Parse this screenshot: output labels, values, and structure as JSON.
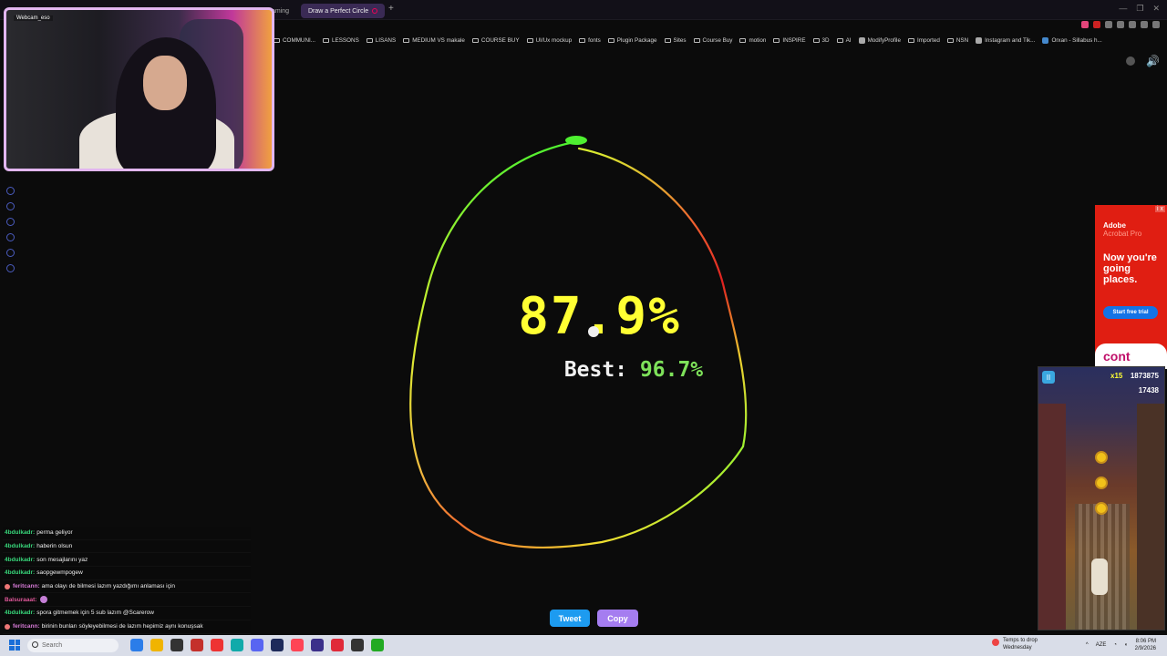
{
  "browser": {
    "tabs": [
      {
        "label": "aming"
      },
      {
        "label": "Draw a Perfect Circle"
      }
    ],
    "new_tab": "+",
    "window_controls": [
      "—",
      "❐",
      "✕"
    ]
  },
  "bookmarks": [
    {
      "label": "COMMUNI...",
      "kind": "folder"
    },
    {
      "label": "LESSONS",
      "kind": "folder"
    },
    {
      "label": "LISANS",
      "kind": "folder"
    },
    {
      "label": "MEDIUM VS makale",
      "kind": "folder"
    },
    {
      "label": "COURSE BUY",
      "kind": "folder"
    },
    {
      "label": "UI/Ux mockup",
      "kind": "folder"
    },
    {
      "label": "fonts",
      "kind": "folder"
    },
    {
      "label": "Plugin Package",
      "kind": "folder"
    },
    {
      "label": "Sites",
      "kind": "folder"
    },
    {
      "label": "Course Buy",
      "kind": "folder"
    },
    {
      "label": "motion",
      "kind": "folder"
    },
    {
      "label": "INSPIRE",
      "kind": "folder"
    },
    {
      "label": "3D",
      "kind": "folder"
    },
    {
      "label": "AI",
      "kind": "folder"
    },
    {
      "label": "ModifyProfile",
      "kind": "site"
    },
    {
      "label": "Imported",
      "kind": "folder"
    },
    {
      "label": "NSN",
      "kind": "folder"
    },
    {
      "label": "Instagram and Tik...",
      "kind": "site"
    },
    {
      "label": "Orxan - Sillabus h...",
      "kind": "site"
    }
  ],
  "webcam": {
    "label": "Webcam_eso"
  },
  "game_result": {
    "score_text": "87.9%",
    "best_label": "Best:",
    "best_value": "96.7%",
    "tweet_label": "Tweet",
    "copy_label": "Copy",
    "colors": {
      "score": "#ffff33",
      "best": "#7ee25a",
      "tweet": "#1d9bf0",
      "copy": "#a57df0"
    }
  },
  "ad": {
    "close": "i x",
    "brand": "Adobe",
    "product": "Acrobat Pro",
    "headline": "Now you're going places.",
    "cta": "Start free trial",
    "footer": "cont"
  },
  "overlay_game": {
    "pause": "II",
    "multiplier": "x15",
    "score": "1873875",
    "coins": "17438"
  },
  "chat": [
    {
      "user": "4bdulkadr:",
      "text": "perma geliyor",
      "color": "#38d67a"
    },
    {
      "user": "4bdulkadr:",
      "text": "haberin olsun",
      "color": "#38d67a"
    },
    {
      "user": "4bdulkadr:",
      "text": "son mesajlarını yaz",
      "color": "#38d67a"
    },
    {
      "user": "4bdulkadr:",
      "text": "saopgewmpogew",
      "color": "#38d67a"
    },
    {
      "user": "feritcann:",
      "text": "ama olayı de bilmesi lazım yazdığımı anlaması için",
      "color": "#d67ad6"
    },
    {
      "user": "Balsuraaat:",
      "text": "",
      "color": "#e0589a"
    },
    {
      "user": "4bdulkadr:",
      "text": "spora gitmemek için 5 sub lazım @Scarerow",
      "color": "#38d67a"
    },
    {
      "user": "feritcann:",
      "text": "birinin bunları söyleyebilmesi de lazım hepimiz aynı konuşsak",
      "color": "#d67ad6"
    }
  ],
  "taskbar": {
    "search_placeholder": "Search",
    "weather_title": "Temps to drop",
    "weather_sub": "Wednesday",
    "lang": "AZE",
    "time": "8:06 PM",
    "date": "2/9/2026"
  }
}
